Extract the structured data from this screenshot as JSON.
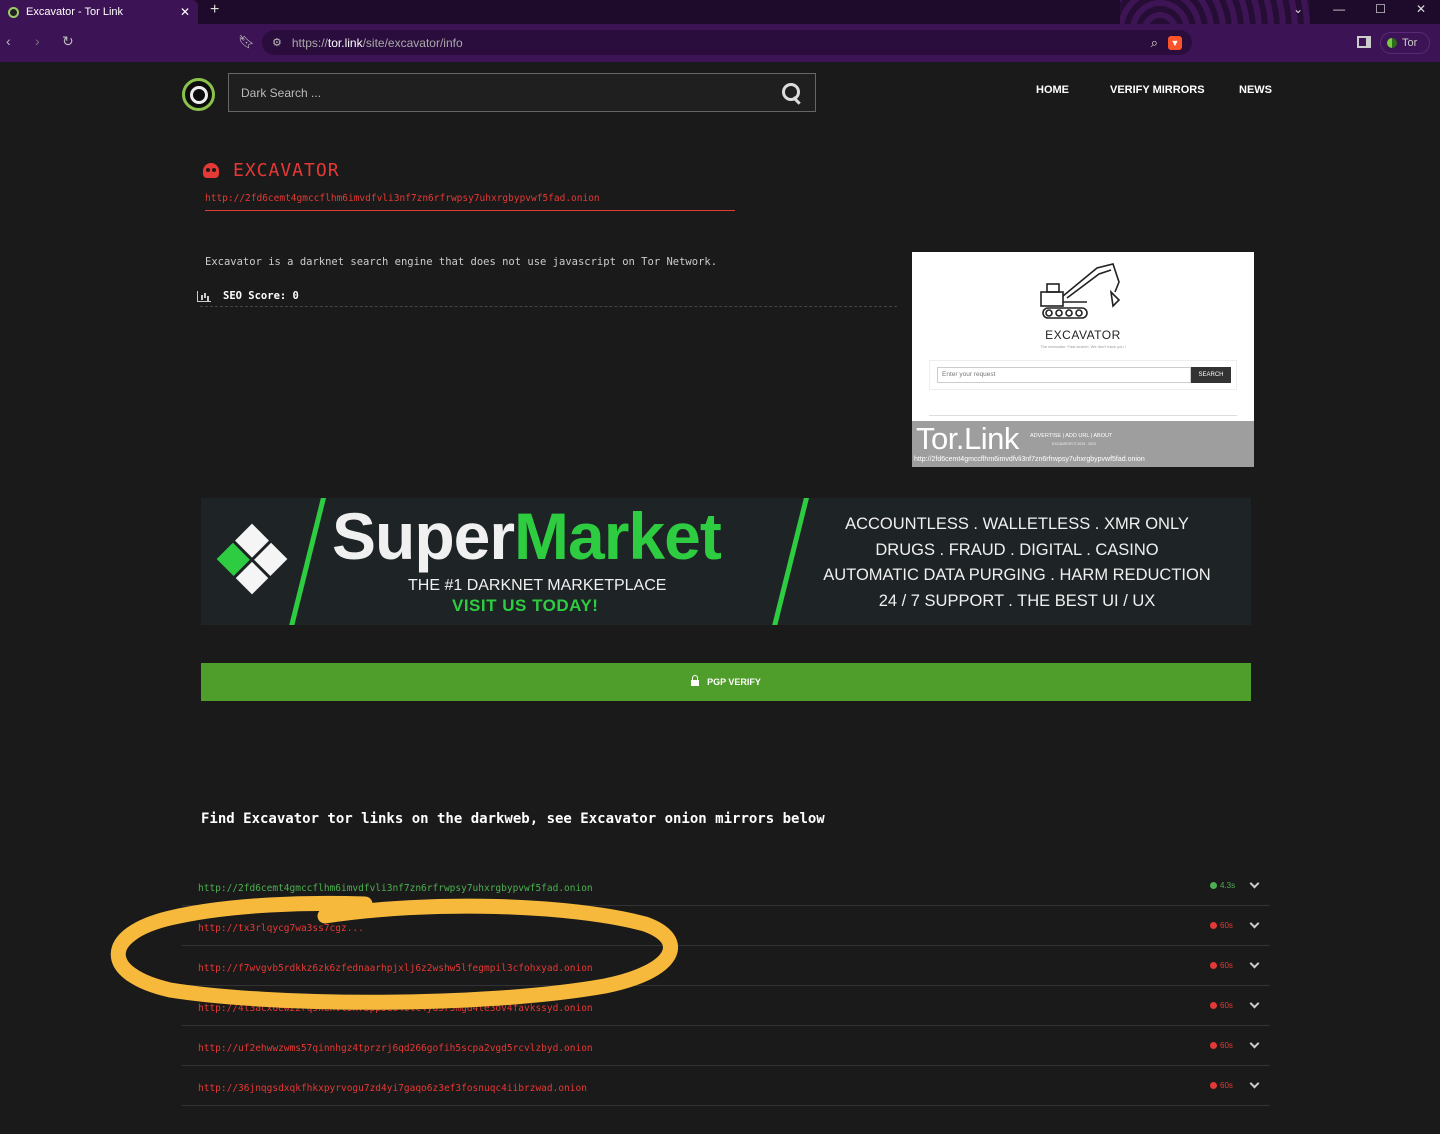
{
  "browser": {
    "tab_title": "Excavator - Tor Link",
    "tab_close": "✕",
    "new_tab": "+",
    "url_prefix": "https://",
    "url_domain": "tor.link",
    "url_path": "/site/excavator/info",
    "tor_label": "Tor"
  },
  "header": {
    "search_placeholder": "Dark Search ...",
    "nav": [
      "HOME",
      "VERIFY MIRRORS",
      "NEWS"
    ]
  },
  "site": {
    "title": "EXCAVATOR",
    "url": "http://2fd6cemt4gmccflhm6imvdfvli3nf7zn6rfrwpsy7uhxrgbypvwf5fad.onion",
    "description": "Excavator is a darknet search engine that does not use javascript on Tor Network.",
    "seo_label": "SEO Score: 0"
  },
  "preview": {
    "brand": "EXCAVATOR",
    "tagline": "The excavator. Fast search. We don't track you !",
    "input_placeholder": "Enter your request",
    "search_button": "SEARCH",
    "watermark": "Tor.Link",
    "footer_links": "ADVERTISE | ADD URL | ABOUT",
    "footer_copy": "EXCAVATOR © 2019 - 2023",
    "footer_url": "http://2fd6cemt4gmccflhm6imvdfvli3nf7zn6rfrwpsy7uhxrgbypvwf5fad.onion"
  },
  "banner": {
    "brand_first": "Super",
    "brand_second": "Market",
    "subtitle": "THE #1 DARKNET MARKETPLACE",
    "cta": "VISIT US TODAY!",
    "features": [
      "ACCOUNTLESS  .  WALLETLESS  .  XMR ONLY",
      "DRUGS  . FRAUD  .  DIGITAL  .  CASINO",
      "AUTOMATIC DATA PURGING  .  HARM REDUCTION",
      "24 / 7 SUPPORT  .  THE BEST UI / UX"
    ],
    "colors": {
      "accent": "#2ecc40",
      "background": "#1e2326"
    }
  },
  "pgp": {
    "label": "PGP VERIFY"
  },
  "mirrors": {
    "heading": "Find Excavator tor links on the darkweb, see Excavator onion mirrors below",
    "items": [
      {
        "url": "http://2fd6cemt4gmccflhm6imvdfvli3nf7zn6rfrwpsy7uhxrgbypvwf5fad.onion",
        "time": "4.3s",
        "status": "online"
      },
      {
        "url": "http://tx3rlqycg7wa3ss7cgz...",
        "time": "60s",
        "status": "offline"
      },
      {
        "url": "http://f7wvgvb5rdkkz6zk6zfednaarhpjxlj6z2wshw5lfegmpil3cfohxyad.onion",
        "time": "60s",
        "status": "offline"
      },
      {
        "url": "http://4l3acx6ew22rq5kehvl5x73pp5eo4olc4yd3r5mgd4le3ov4favkssyd.onion",
        "time": "60s",
        "status": "offline"
      },
      {
        "url": "http://uf2ehwwzwms57qinnhgz4tprzrj6qd266gofih5scpa2vgd5rcvlzbyd.onion",
        "time": "60s",
        "status": "offline"
      },
      {
        "url": "http://36jnqgsdxqkfhkxpyrvogu7zd4yi7gaqo6z3ef3fosnuqc4iibrzwad.onion",
        "time": "60s",
        "status": "offline"
      }
    ]
  },
  "colors": {
    "brand_red": "#e53935",
    "online_green": "#4caf50",
    "pgp_green": "#4f9d2a",
    "highlight": "#f6b93b"
  }
}
